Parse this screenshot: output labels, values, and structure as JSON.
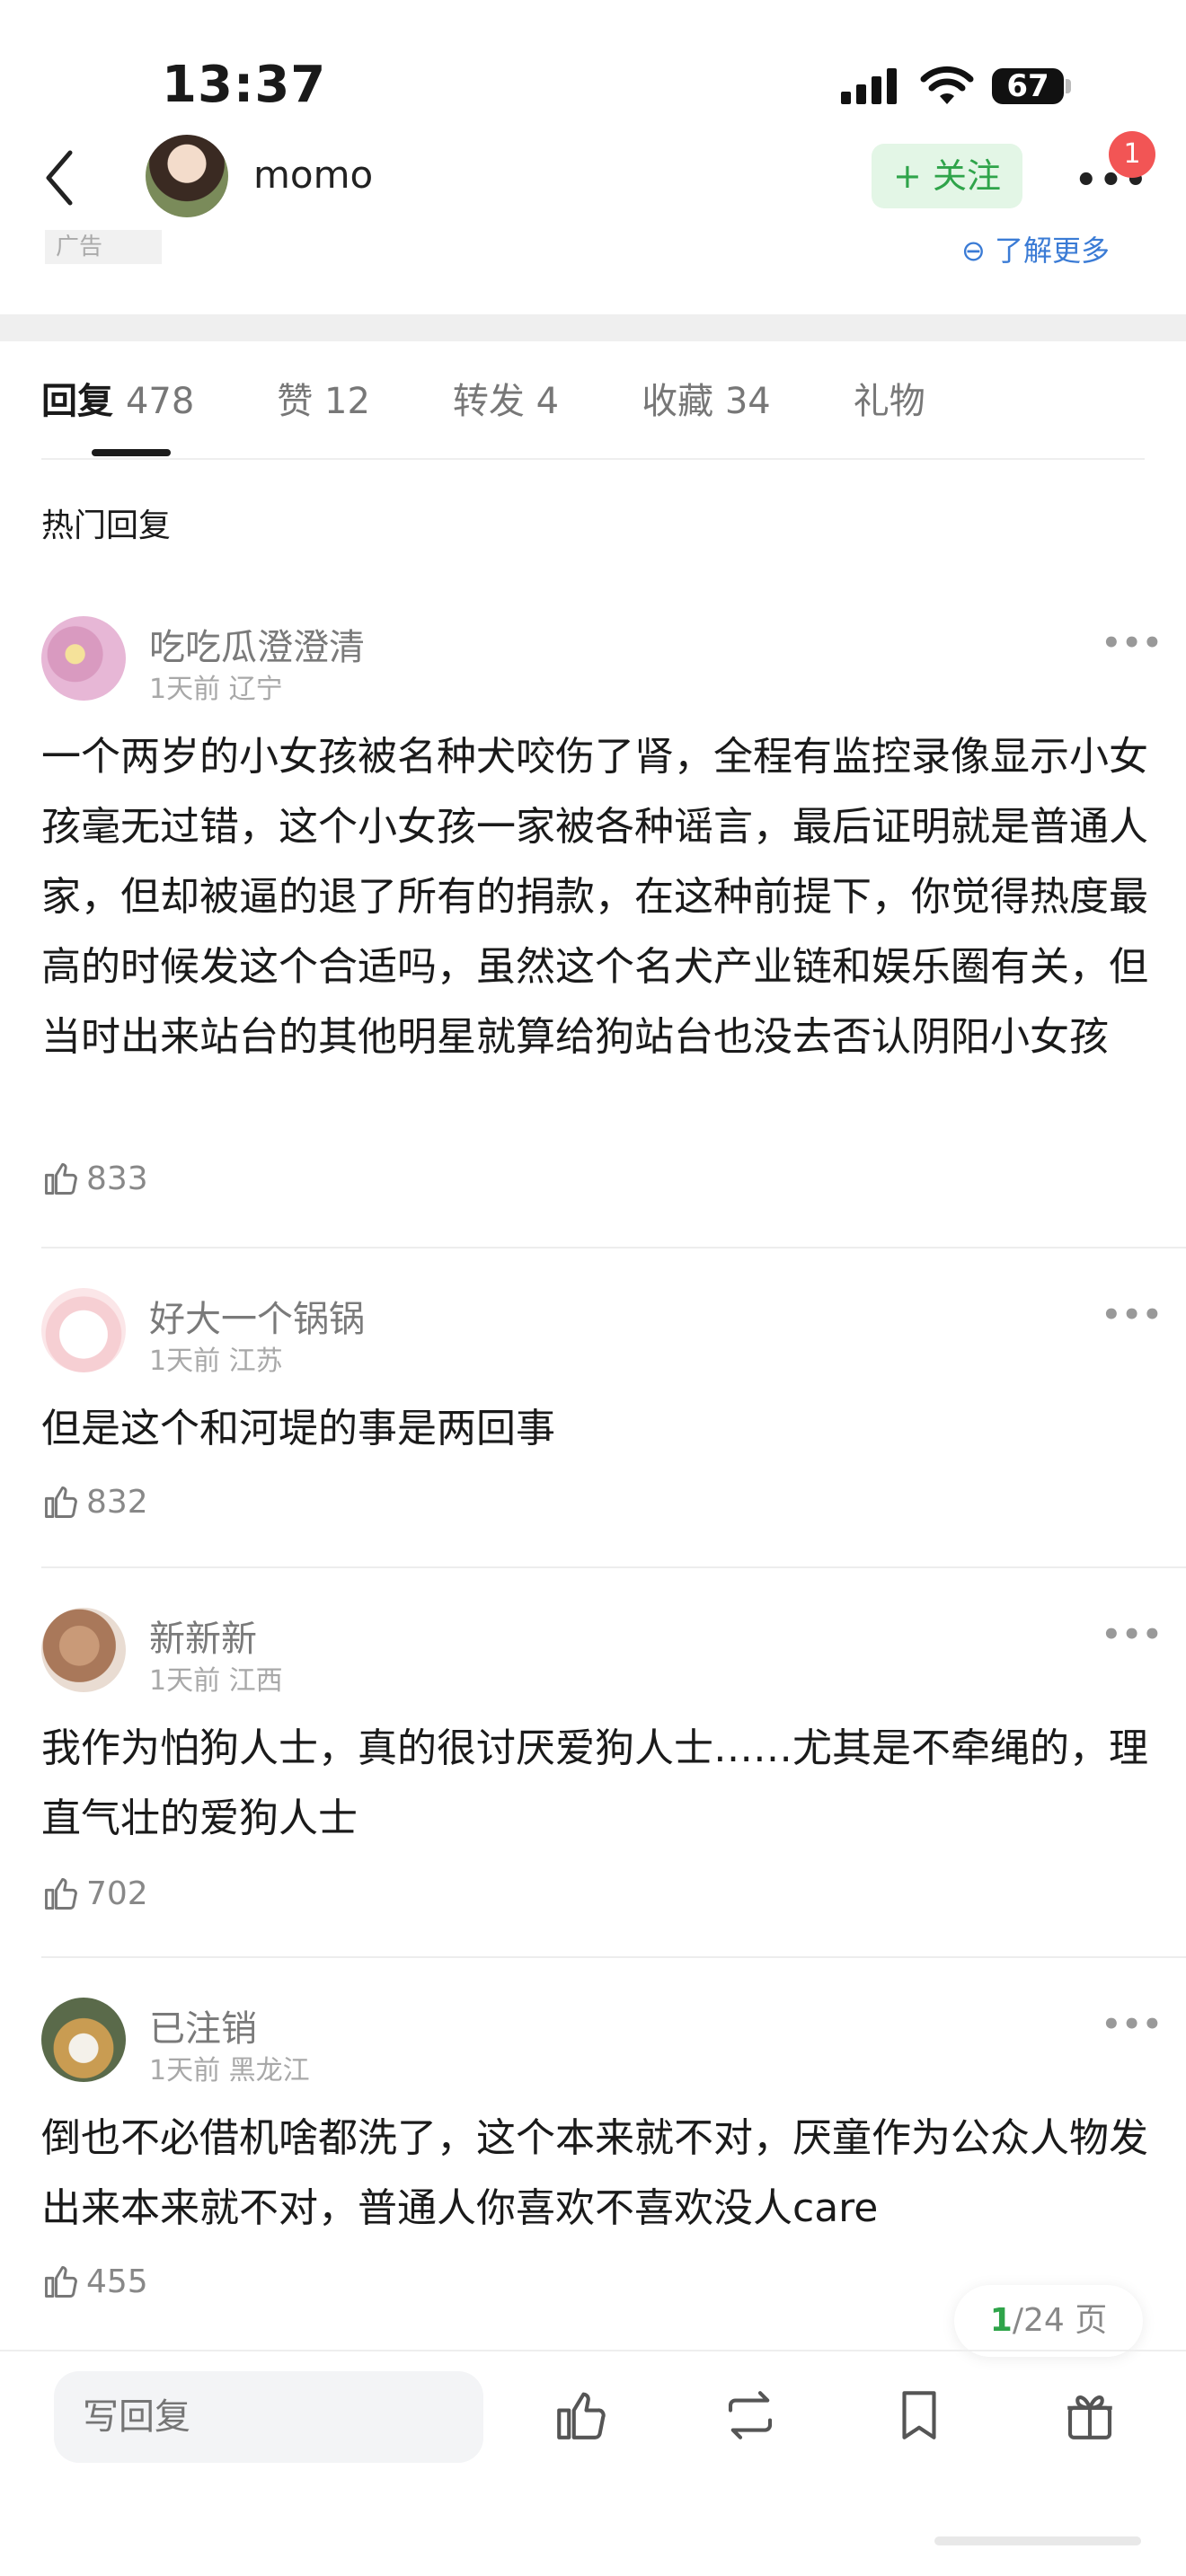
{
  "status_bar": {
    "time": "13:37",
    "battery": "67"
  },
  "header": {
    "username": "momo",
    "follow_label": "+ 关注",
    "notification_count": "1",
    "ad_label": "广告",
    "ad_more": "了解更多"
  },
  "tabs": [
    {
      "label": "回复",
      "count": "478"
    },
    {
      "label": "赞",
      "count": "12"
    },
    {
      "label": "转发",
      "count": "4"
    },
    {
      "label": "收藏",
      "count": "34"
    },
    {
      "label": "礼物",
      "count": ""
    }
  ],
  "section_title": "热门回复",
  "comments": [
    {
      "name": "吃吃瓜澄澄清",
      "time": "1天前",
      "location": "辽宁",
      "text": "一个两岁的小女孩被名种犬咬伤了肾，全程有监控录像显示小女孩毫无过错，这个小女孩一家被各种谣言，最后证明就是普通人家，但却被逼的退了所有的捐款，在这种前提下，你觉得热度最高的时候发这个合适吗，虽然这个名犬产业链和娱乐圈有关，但当时出来站台的其他明星就算给狗站台也没去否认阴阳小女孩",
      "likes": "833"
    },
    {
      "name": "好大一个锅锅",
      "time": "1天前",
      "location": "江苏",
      "text": "但是这个和河堤的事是两回事",
      "likes": "832"
    },
    {
      "name": "新新新",
      "time": "1天前",
      "location": "江西",
      "text": "我作为怕狗人士，真的很讨厌爱狗人士……尤其是不牵绳的，理直气壮的爱狗人士",
      "likes": "702"
    },
    {
      "name": "已注销",
      "time": "1天前",
      "location": "黑龙江",
      "text": "倒也不必借机啥都洗了，这个本来就不对，厌童作为公众人物发出来本来就不对，普通人你喜欢不喜欢没人care",
      "likes": "455"
    }
  ],
  "pagination": {
    "current": "1",
    "total_text": "/24 页"
  },
  "bottom_bar": {
    "reply_placeholder": "写回复"
  },
  "colors": {
    "accent_green": "#2fa44a",
    "badge_red": "#f25555",
    "link_blue": "#3a7bd5"
  }
}
